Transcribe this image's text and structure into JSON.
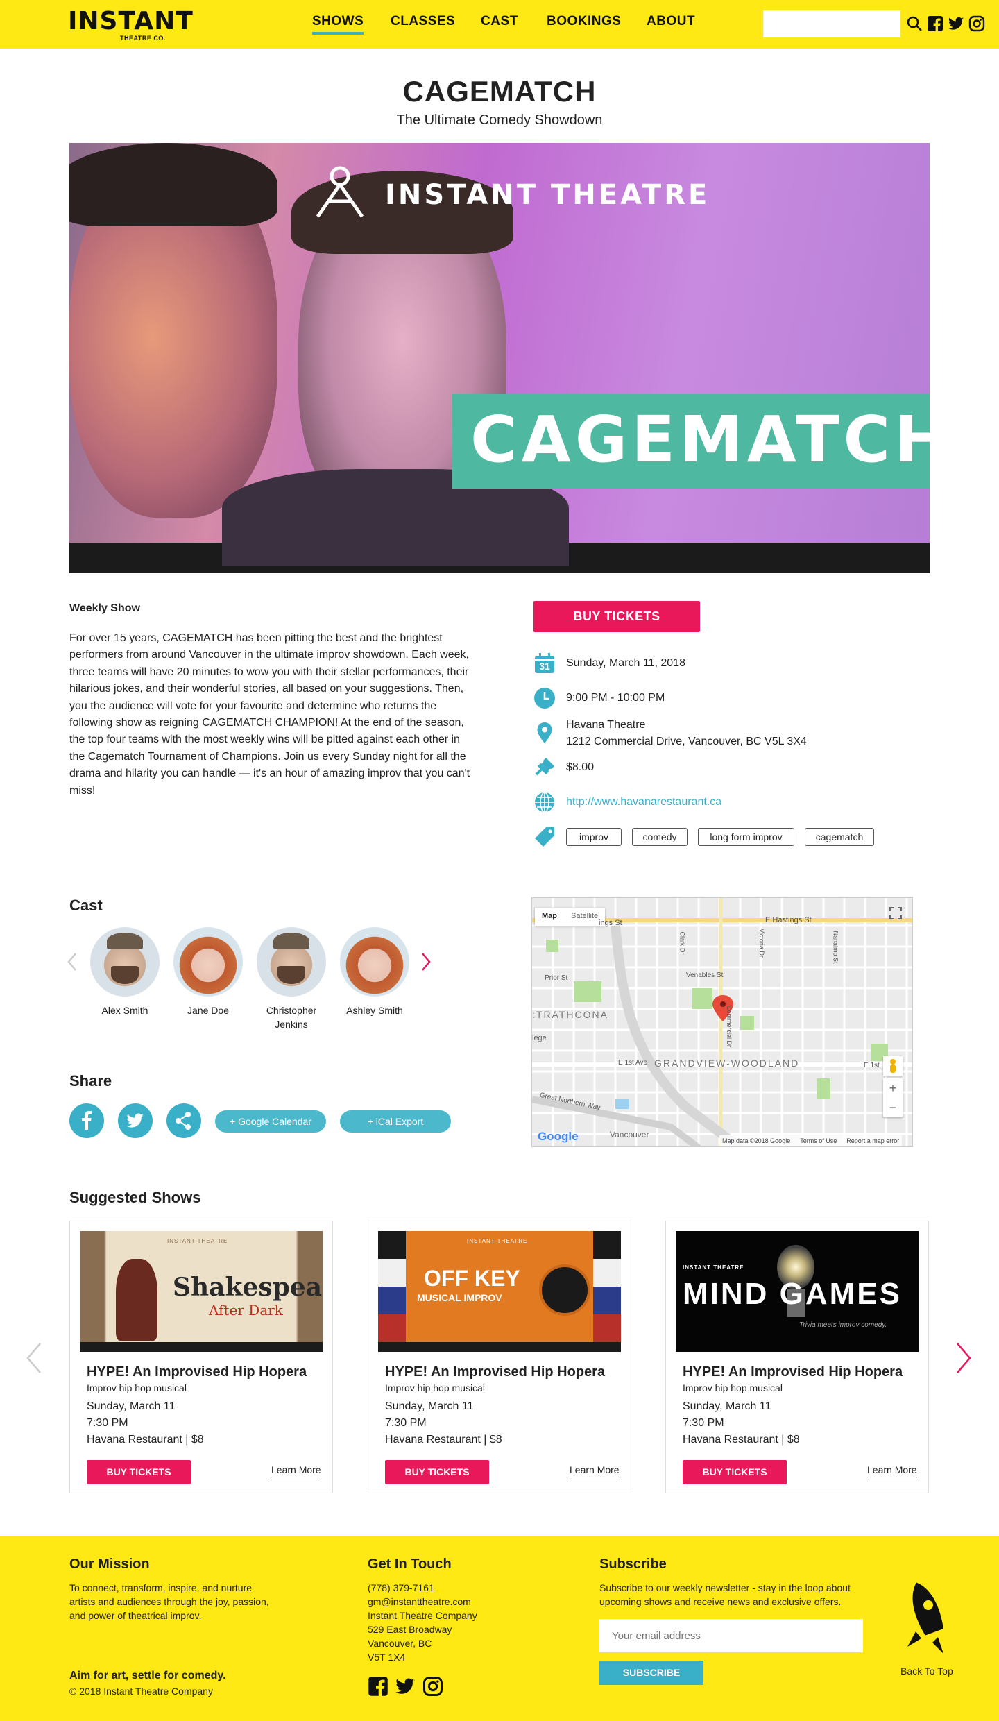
{
  "header": {
    "logo_main": "INSTANT",
    "logo_sub": "THEATRE CO.",
    "nav": [
      "SHOWS",
      "CLASSES",
      "CAST",
      "BOOKINGS",
      "ABOUT"
    ],
    "search_placeholder": "",
    "icons": [
      "search-icon",
      "facebook-icon",
      "twitter-icon",
      "instagram-icon"
    ]
  },
  "page": {
    "title": "CAGEMATCH",
    "subtitle": "The Ultimate Comedy Showdown"
  },
  "hero": {
    "brand": "INSTANT THEATRE",
    "band_text": "CAGEMATCH"
  },
  "show": {
    "type": "Weekly Show",
    "description": "For over 15 years, CAGEMATCH has been pitting the best and the brightest performers from around Vancouver in the ultimate improv showdown. Each week, three teams will have 20 minutes to wow you with their stellar performances, their hilarious jokes, and their wonderful stories, all based on your suggestions. Then, you the audience will vote for your favourite and determine who returns the following show as reigning CAGEMATCH CHAMPION! At the end of the season, the top four teams with the most weekly wins will be pitted against each other in the Cagematch Tournament of Champions. Join us every Sunday night for all the drama and hilarity you can handle — it's an hour of amazing improv that you can't miss!",
    "buy_label": "BUY TICKETS",
    "calendar_day": "31",
    "date": "Sunday, March 11, 2018",
    "time": "9:00 PM - 10:00 PM",
    "venue": "Havana Theatre",
    "address": "1212 Commercial Drive, Vancouver, BC V5L 3X4",
    "price": "$8.00",
    "url": "http://www.havanarestaurant.ca",
    "tags": [
      "improv",
      "comedy",
      "long form improv",
      "cagematch"
    ]
  },
  "cast": {
    "heading": "Cast",
    "members": [
      "Alex Smith",
      "Jane Doe",
      "Christopher Jenkins",
      "Ashley Smith"
    ]
  },
  "share": {
    "heading": "Share",
    "google_label": "+ Google Calendar",
    "ical_label": "+ iCal Export"
  },
  "map": {
    "tab_map": "Map",
    "tab_satellite": "Satellite",
    "labels": {
      "hastings": "E Hastings St",
      "hastings_left": "ings St",
      "strathcona": ":TRATHCONA",
      "grandview": "GRANDVIEW-WOODLAND",
      "prior": "Prior St",
      "venables": "Venables St",
      "first_ave": "E 1st Ave",
      "first_right": "E 1st",
      "great_northern": "Great Northern Way",
      "college": "lege",
      "vancouver": "Vancouver",
      "commercial": "Commercial Dr",
      "victoria": "Victoria Dr",
      "nanaimo": "Nanaimo St",
      "clark": "Clark Dr"
    },
    "google": "Google",
    "map_data": "Map data ©2018 Google",
    "terms": "Terms of Use",
    "report": "Report a map error",
    "zoom_in": "+",
    "zoom_out": "−"
  },
  "suggested": {
    "heading": "Suggested Shows",
    "cards": [
      {
        "img_title": "Shakespeare",
        "img_sub": "After Dark",
        "img_brand": "INSTANT THEATRE",
        "title": "HYPE! An Improvised Hip Hopera",
        "sub": "Improv hip hop musical",
        "date": "Sunday, March 11",
        "time": "7:30 PM",
        "venue": "Havana Restaurant | $8",
        "buy": "BUY TICKETS",
        "more": "Learn More"
      },
      {
        "img_title": "OFF KEY",
        "img_sub": "MUSICAL IMPROV",
        "img_brand": "INSTANT THEATRE",
        "title": "HYPE! An Improvised Hip Hopera",
        "sub": "Improv hip hop musical",
        "date": "Sunday, March 11",
        "time": "7:30 PM",
        "venue": "Havana Restaurant | $8",
        "buy": "BUY TICKETS",
        "more": "Learn More"
      },
      {
        "img_title": "MIND GAMES",
        "img_sub": "Trivia meets improv comedy.",
        "img_brand": "INSTANT THEATRE",
        "title": "HYPE! An Improvised Hip Hopera",
        "sub": "Improv hip hop musical",
        "date": "Sunday, March 11",
        "time": "7:30 PM",
        "venue": "Havana Restaurant | $8",
        "buy": "BUY TICKETS",
        "more": "Learn More"
      }
    ]
  },
  "footer": {
    "mission_heading": "Our Mission",
    "mission_text": "To connect, transform, inspire, and nurture artists and audiences through the joy, passion, and power of theatrical improv.",
    "tagline": "Aim for art, settle for comedy.",
    "copyright": "© 2018 Instant Theatre Company",
    "contact_heading": "Get In Touch",
    "contact_lines": [
      "(778) 379-7161",
      "gm@instanttheatre.com",
      "Instant Theatre Company",
      "529 East Broadway",
      "Vancouver, BC",
      "V5T 1X4"
    ],
    "subscribe_heading": "Subscribe",
    "subscribe_text": "Subscribe to our weekly newsletter - stay in the loop about upcoming shows and receive news and exclusive offers.",
    "email_placeholder": "Your email address",
    "subscribe_btn": "SUBSCRIBE",
    "back_to_top": "Back To Top"
  },
  "colors": {
    "yellow": "#ffe914",
    "pink": "#e8185a",
    "teal": "#3ab0c8",
    "band_green": "#4fb8a0"
  }
}
